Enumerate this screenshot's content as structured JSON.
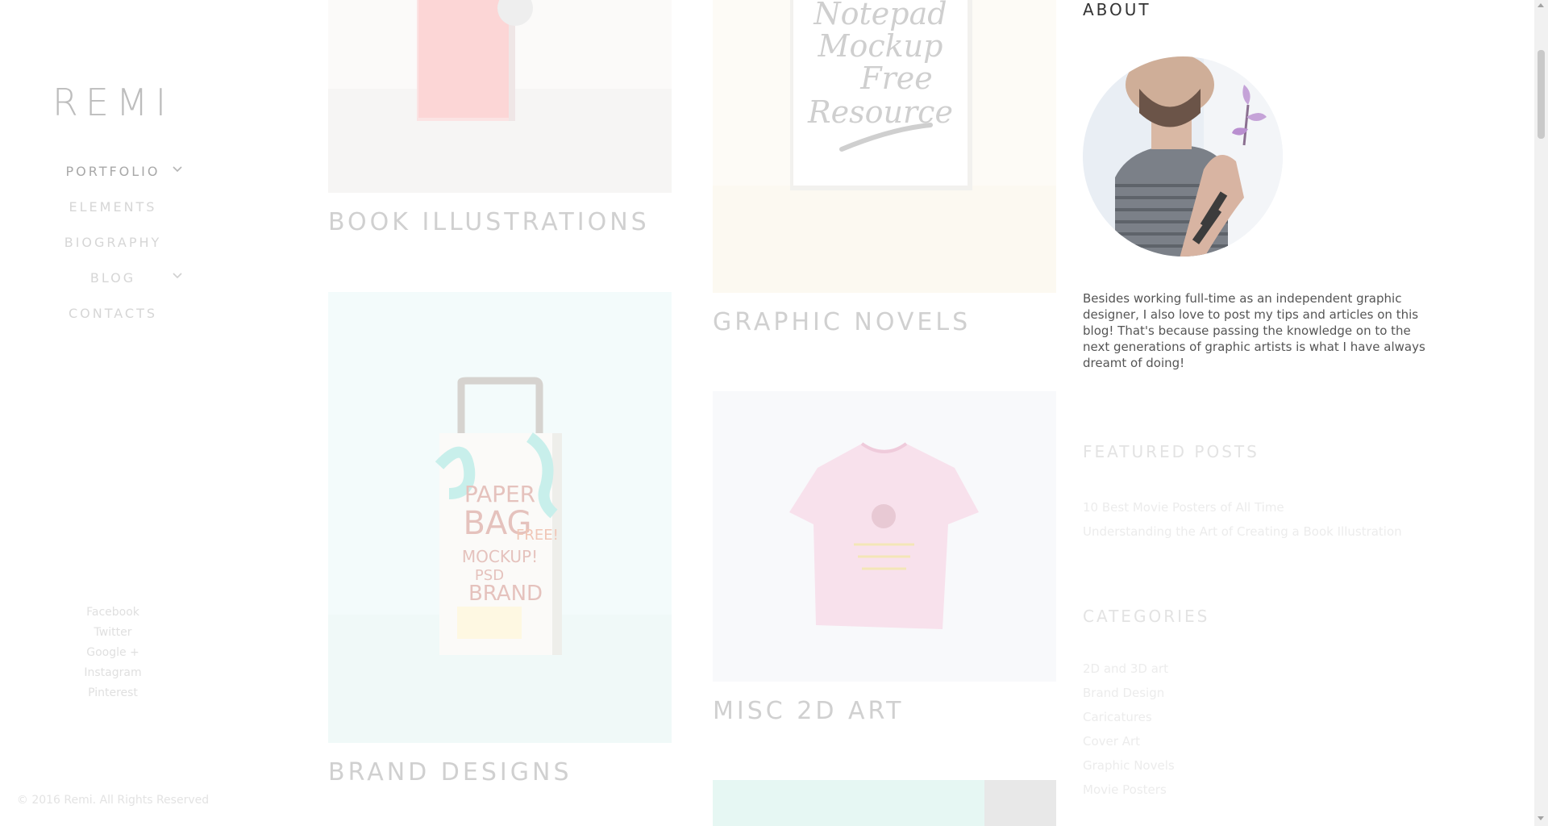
{
  "logo": "REMI",
  "nav": [
    {
      "label": "PORTFOLIO",
      "has_submenu": true
    },
    {
      "label": "ELEMENTS",
      "has_submenu": false
    },
    {
      "label": "BIOGRAPHY",
      "has_submenu": false
    },
    {
      "label": "BLOG",
      "has_submenu": true
    },
    {
      "label": "CONTACTS",
      "has_submenu": false
    }
  ],
  "social": [
    "Facebook",
    "Twitter",
    "Google +",
    "Instagram",
    "Pinterest"
  ],
  "copyright": "© 2016 Remi. All Rights Reserved",
  "portfolio": [
    {
      "title": "BOOK ILLUSTRATIONS"
    },
    {
      "title": "GRAPHIC NOVELS"
    },
    {
      "title": "BRAND DESIGNS"
    },
    {
      "title": "MISC 2D ART"
    }
  ],
  "mockup_text": {
    "notepad": [
      "Notepad",
      "Mockup",
      "Free",
      "Resource"
    ],
    "bag": [
      "PAPER",
      "BAG",
      "FREE!",
      "MOCKUP!",
      "PSD",
      "BRAND"
    ]
  },
  "about": {
    "title": "ABOUT",
    "text": "Besides working full-time as an independent graphic designer, I also love to post my tips and articles on this blog! That's because passing the knowledge on to the next generations of graphic artists is what I have always dreamt of doing!"
  },
  "featured": {
    "title": "FEATURED POSTS",
    "posts": [
      "10 Best Movie Posters of All Time",
      "Understanding the Art of Creating a Book Illustration"
    ]
  },
  "categories": {
    "title": "CATEGORIES",
    "items": [
      "2D and 3D art",
      "Brand Design",
      "Caricatures",
      "Cover Art",
      "Graphic Novels",
      "Movie Posters"
    ]
  },
  "icons": {
    "submenu": "chevron-down-icon"
  }
}
